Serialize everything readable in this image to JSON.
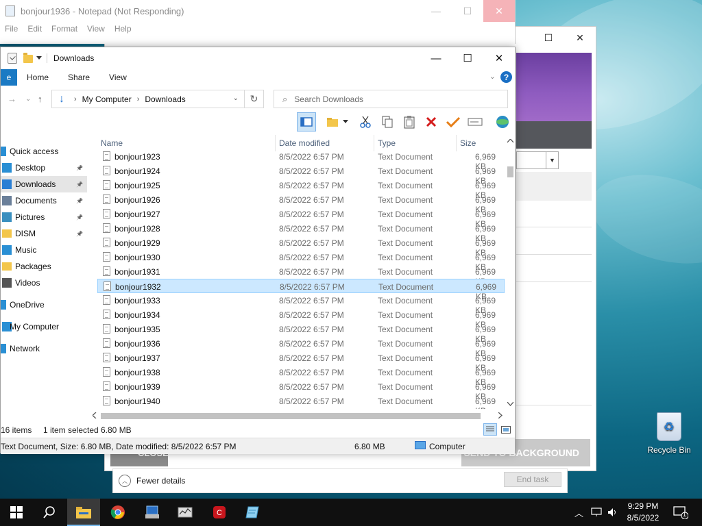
{
  "notepad": {
    "title": "bonjour1936 - Notepad (Not Responding)",
    "menu": [
      "File",
      "Edit",
      "Format",
      "View",
      "Help"
    ]
  },
  "taskmgr": {
    "close_label": "CLOSE",
    "send_label": "SEND TO BACKGROUND",
    "fewer_details": "Fewer details",
    "end_task": "End task"
  },
  "explorer": {
    "title": "Downloads",
    "tabs": [
      "Home",
      "Share",
      "View"
    ],
    "file_tab": "e",
    "breadcrumb": [
      "My Computer",
      "Downloads"
    ],
    "search_placeholder": "Search Downloads",
    "nav": [
      {
        "label": "Quick access",
        "icon": "star-icon"
      },
      {
        "label": "Desktop",
        "icon": "desktop-icon",
        "pinned": true
      },
      {
        "label": "Downloads",
        "icon": "download-icon",
        "pinned": true,
        "selected": true
      },
      {
        "label": "Documents",
        "icon": "documents-icon",
        "pinned": true
      },
      {
        "label": "Pictures",
        "icon": "pictures-icon",
        "pinned": true
      },
      {
        "label": "DISM",
        "icon": "folder-icon",
        "pinned": true
      },
      {
        "label": "Music",
        "icon": "music-icon"
      },
      {
        "label": "Packages",
        "icon": "folder-icon"
      },
      {
        "label": "Videos",
        "icon": "videos-icon"
      },
      {
        "label": "OneDrive",
        "icon": "cloud-icon"
      },
      {
        "label": "My Computer",
        "icon": "computer-icon"
      },
      {
        "label": "Network",
        "icon": "network-icon"
      }
    ],
    "columns": [
      "Name",
      "Date modified",
      "Type",
      "Size"
    ],
    "files": [
      {
        "name": "bonjour1923",
        "date": "8/5/2022 6:57 PM",
        "type": "Text Document",
        "size": "6,969 KB"
      },
      {
        "name": "bonjour1924",
        "date": "8/5/2022 6:57 PM",
        "type": "Text Document",
        "size": "6,969 KB"
      },
      {
        "name": "bonjour1925",
        "date": "8/5/2022 6:57 PM",
        "type": "Text Document",
        "size": "6,969 KB"
      },
      {
        "name": "bonjour1926",
        "date": "8/5/2022 6:57 PM",
        "type": "Text Document",
        "size": "6,969 KB"
      },
      {
        "name": "bonjour1927",
        "date": "8/5/2022 6:57 PM",
        "type": "Text Document",
        "size": "6,969 KB"
      },
      {
        "name": "bonjour1928",
        "date": "8/5/2022 6:57 PM",
        "type": "Text Document",
        "size": "6,969 KB"
      },
      {
        "name": "bonjour1929",
        "date": "8/5/2022 6:57 PM",
        "type": "Text Document",
        "size": "6,969 KB"
      },
      {
        "name": "bonjour1930",
        "date": "8/5/2022 6:57 PM",
        "type": "Text Document",
        "size": "6,969 KB"
      },
      {
        "name": "bonjour1931",
        "date": "8/5/2022 6:57 PM",
        "type": "Text Document",
        "size": "6,969 KB"
      },
      {
        "name": "bonjour1932",
        "date": "8/5/2022 6:57 PM",
        "type": "Text Document",
        "size": "6,969 KB",
        "selected": true
      },
      {
        "name": "bonjour1933",
        "date": "8/5/2022 6:57 PM",
        "type": "Text Document",
        "size": "6,969 KB"
      },
      {
        "name": "bonjour1934",
        "date": "8/5/2022 6:57 PM",
        "type": "Text Document",
        "size": "6,969 KB"
      },
      {
        "name": "bonjour1935",
        "date": "8/5/2022 6:57 PM",
        "type": "Text Document",
        "size": "6,969 KB"
      },
      {
        "name": "bonjour1936",
        "date": "8/5/2022 6:57 PM",
        "type": "Text Document",
        "size": "6,969 KB"
      },
      {
        "name": "bonjour1937",
        "date": "8/5/2022 6:57 PM",
        "type": "Text Document",
        "size": "6,969 KB"
      },
      {
        "name": "bonjour1938",
        "date": "8/5/2022 6:57 PM",
        "type": "Text Document",
        "size": "6,969 KB"
      },
      {
        "name": "bonjour1939",
        "date": "8/5/2022 6:57 PM",
        "type": "Text Document",
        "size": "6,969 KB"
      },
      {
        "name": "bonjour1940",
        "date": "8/5/2022 6:57 PM",
        "type": "Text Document",
        "size": "6,969 KB"
      }
    ],
    "status": {
      "items": "16 items",
      "selected": "1 item selected",
      "selected_size": "6.80 MB"
    },
    "details": {
      "info": "Text Document, Size: 6.80 MB, Date modified: 8/5/2022 6:57 PM",
      "size": "6.80 MB",
      "location": "Computer"
    }
  },
  "desktop": {
    "recycle_bin": "Recycle Bin"
  },
  "taskbar": {
    "apps": [
      "start-icon",
      "search-icon",
      "file-explorer-icon",
      "chrome-icon",
      "app-installer-icon",
      "system-monitor-icon",
      "red-app-icon",
      "notepad-icon"
    ],
    "time": "9:29 PM",
    "date": "8/5/2022",
    "notification_count": "1"
  }
}
